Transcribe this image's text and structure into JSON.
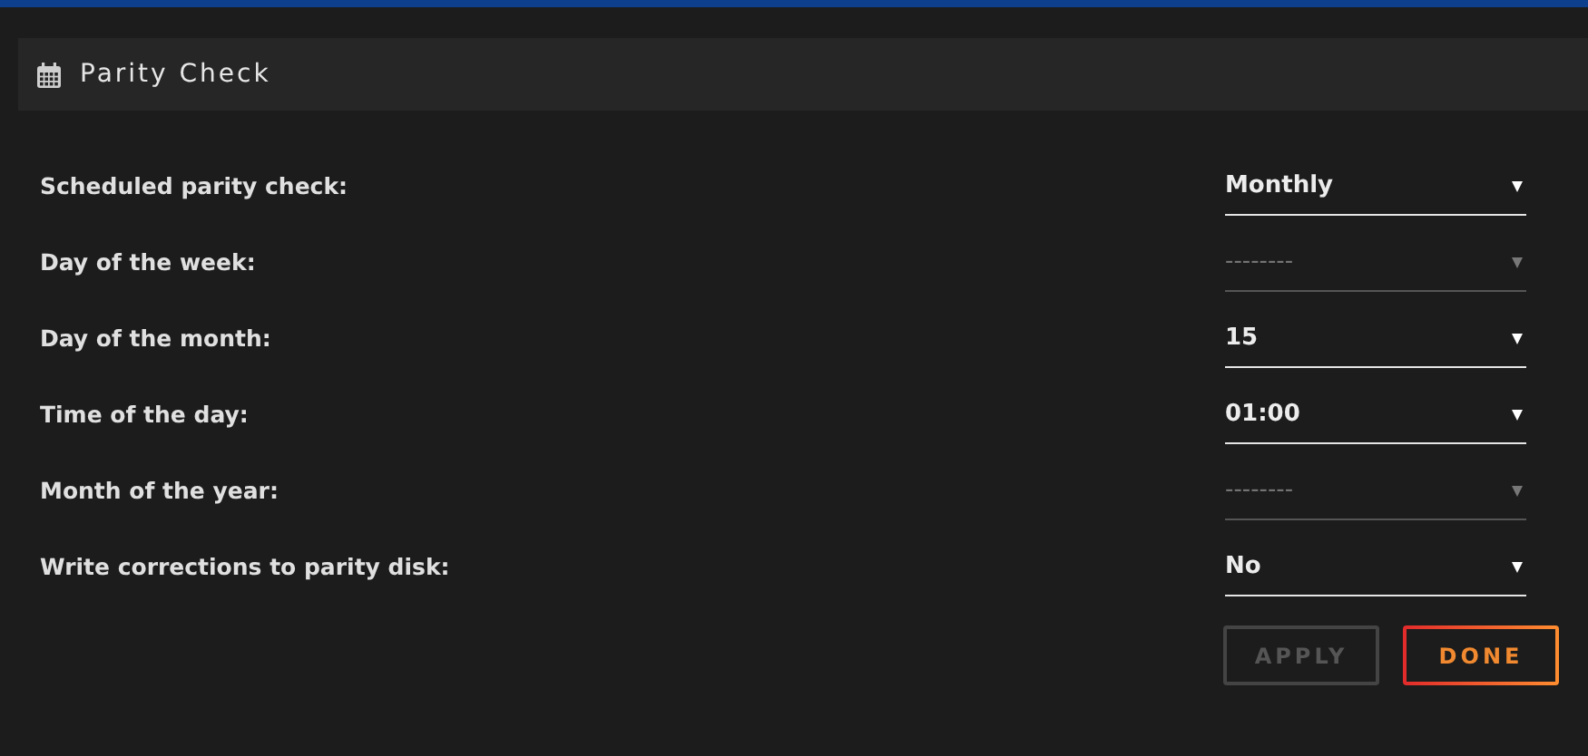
{
  "panel": {
    "title": "Parity Check"
  },
  "settings": [
    {
      "label": "Scheduled parity check:",
      "value": "Monthly",
      "disabled": false
    },
    {
      "label": "Day of the week:",
      "value": "--------",
      "disabled": true
    },
    {
      "label": "Day of the month:",
      "value": "15",
      "disabled": false
    },
    {
      "label": "Time of the day:",
      "value": "01:00",
      "disabled": false
    },
    {
      "label": "Month of the year:",
      "value": "--------",
      "disabled": true
    },
    {
      "label": "Write corrections to parity disk:",
      "value": "No",
      "disabled": false
    }
  ],
  "buttons": [
    {
      "label": "APPLY",
      "disabled": true,
      "kind": "secondary"
    },
    {
      "label": "DONE",
      "disabled": false,
      "kind": "primary"
    }
  ]
}
